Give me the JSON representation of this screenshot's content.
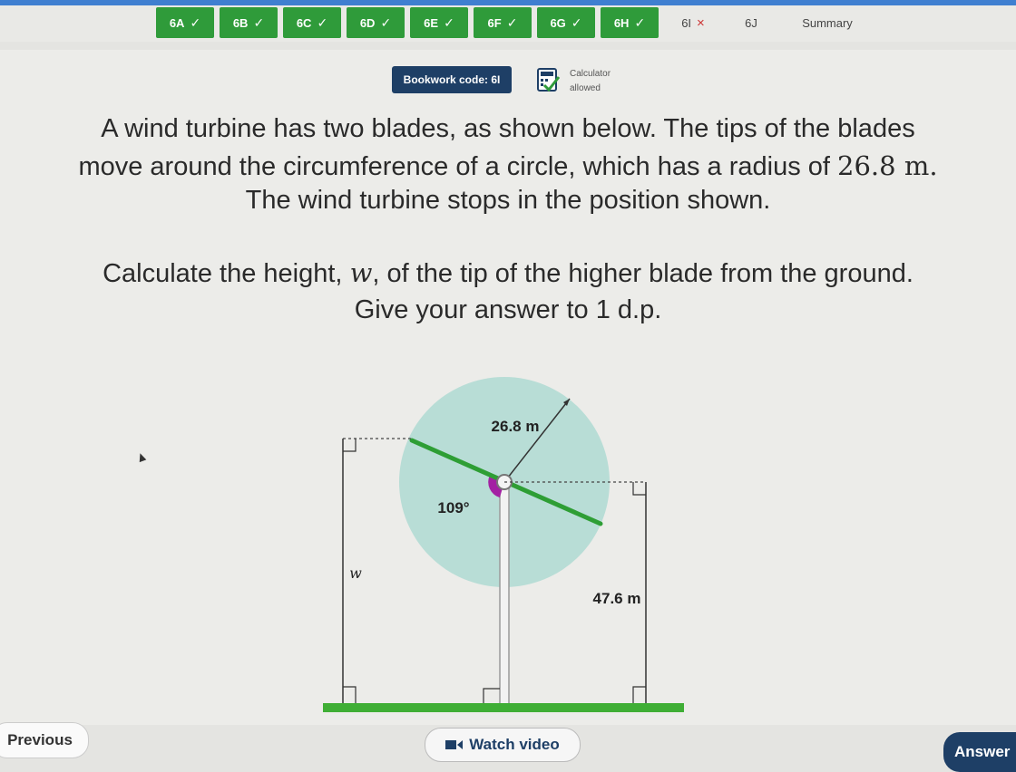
{
  "tabs": [
    {
      "label": "6A",
      "status": "correct"
    },
    {
      "label": "6B",
      "status": "correct"
    },
    {
      "label": "6C",
      "status": "correct"
    },
    {
      "label": "6D",
      "status": "correct"
    },
    {
      "label": "6E",
      "status": "correct"
    },
    {
      "label": "6F",
      "status": "correct"
    },
    {
      "label": "6G",
      "status": "correct"
    },
    {
      "label": "6H",
      "status": "correct"
    },
    {
      "label": "6I",
      "status": "incorrect"
    },
    {
      "label": "6J",
      "status": "unanswered"
    },
    {
      "label": "Summary",
      "status": "plain"
    }
  ],
  "tab_marks": {
    "correct": "✓",
    "incorrect": "×"
  },
  "header": {
    "bookwork_code": "Bookwork code: 6I",
    "calculator_line1": "Calculator",
    "calculator_line2": "allowed"
  },
  "question": {
    "line1": "A wind turbine has two blades, as shown below. The tips of the blades",
    "line2_pre": "move around the circumference of a circle, which has a radius of ",
    "line2_value": "26.8 m.",
    "line3": "The wind turbine stops in the position shown.",
    "line4_pre": "Calculate the height, ",
    "line4_var": "w",
    "line4_post": ", of the tip of the higher blade from the ground.",
    "line5": "Give your answer to 1 d.p."
  },
  "diagram": {
    "radius_label": "26.8 m",
    "angle_label": "109°",
    "height_label": "47.6 m",
    "unknown_label": "w"
  },
  "buttons": {
    "previous": "Previous",
    "watch_video": "Watch video",
    "answer": "Answer"
  },
  "colors": {
    "tab_green": "#2f9b3a",
    "navy": "#1e3f66",
    "disc": "#b8ddd6",
    "blade": "#33a33a",
    "angle": "#a321a3",
    "ground": "#3fae35"
  }
}
